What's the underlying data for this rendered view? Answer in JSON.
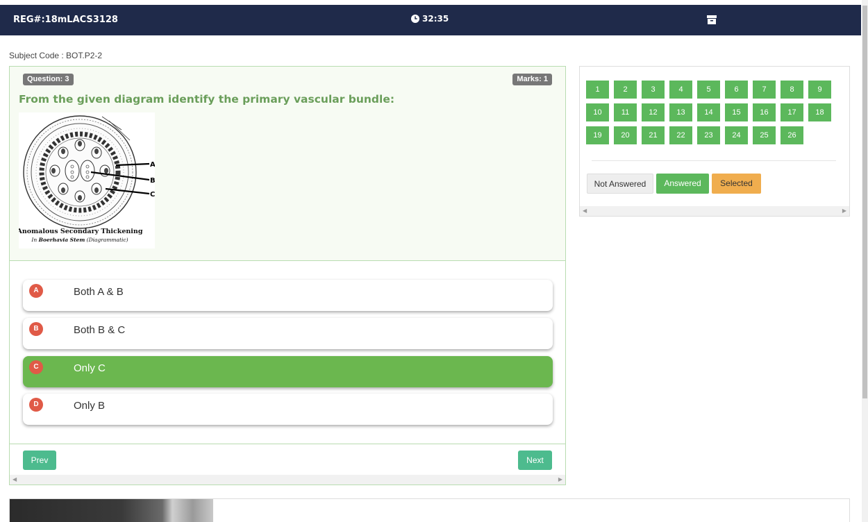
{
  "header": {
    "reg": "REG#:18mLACS3128",
    "timer": "32:35"
  },
  "subject_code": "Subject Code : BOT.P2-2",
  "question": {
    "number_label": "Question: 3",
    "marks_label": "Marks: 1",
    "text": "From the given diagram identify the primary vascular bundle:",
    "diagram": {
      "labels": [
        "A",
        "B",
        "C"
      ],
      "caption_title": "Anomalous Secondary Thickening",
      "caption_sub_prefix": "In ",
      "caption_sub_bold": "Boerhavia Stem",
      "caption_sub_suffix": " (Diagrammatic)"
    },
    "options": [
      {
        "letter": "A",
        "text": "Both A & B",
        "selected": false
      },
      {
        "letter": "B",
        "text": "Both B & C",
        "selected": false
      },
      {
        "letter": "C",
        "text": "Only C",
        "selected": true
      },
      {
        "letter": "D",
        "text": "Only B",
        "selected": false
      }
    ],
    "prev_label": "Prev",
    "next_label": "Next"
  },
  "navigator": {
    "numbers": [
      "1",
      "2",
      "3",
      "4",
      "5",
      "6",
      "7",
      "8",
      "9",
      "10",
      "11",
      "12",
      "13",
      "14",
      "15",
      "16",
      "17",
      "18",
      "19",
      "20",
      "21",
      "22",
      "23",
      "24",
      "25",
      "26"
    ],
    "legend": {
      "not_answered": "Not Answered",
      "answered": "Answered",
      "selected": "Selected"
    }
  },
  "colors": {
    "navbar": "#1f2a4a",
    "answered": "#5cb85c",
    "selected_option": "#6bb74f",
    "option_letter": "#e05a47",
    "nav_button": "#4dbb8e",
    "legend_selected": "#f0ad4e"
  },
  "icons": {
    "timer": "clock-icon",
    "archive": "archive-icon"
  }
}
